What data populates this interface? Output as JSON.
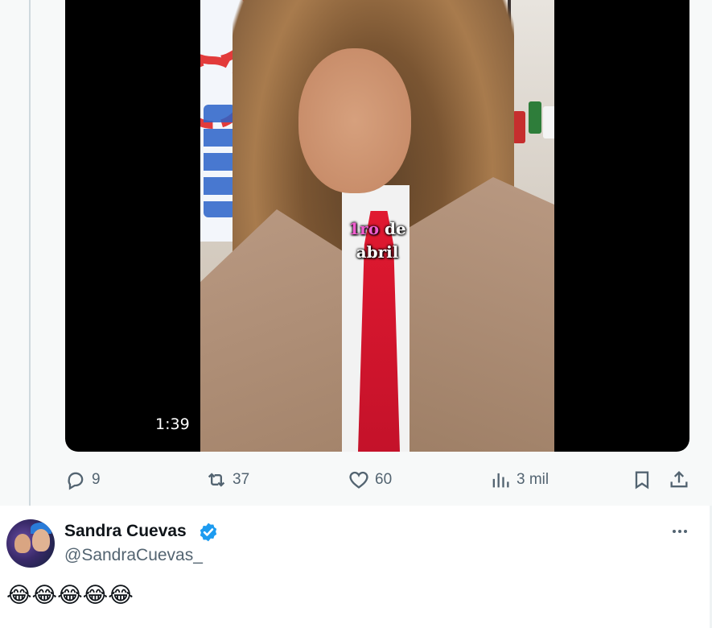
{
  "video": {
    "duration": "1:39",
    "caption_line1_a": "1ro",
    "caption_line1_b": "de",
    "caption_line2": "abril"
  },
  "actions": {
    "replies": "9",
    "reposts": "37",
    "likes": "60",
    "views": "3 mil"
  },
  "reply_tweet": {
    "display_name": "Sandra Cuevas",
    "handle": "@SandraCuevas_",
    "text": "😂😂😂😂😂",
    "verified": true
  },
  "colors": {
    "verified_badge": "#1d9bf0",
    "muted_text": "#536471",
    "caption_pink": "#f05ccf"
  },
  "icons": [
    "reply-icon",
    "repost-icon",
    "like-icon",
    "views-icon",
    "bookmark-icon",
    "share-icon",
    "verified-icon",
    "more-icon"
  ]
}
